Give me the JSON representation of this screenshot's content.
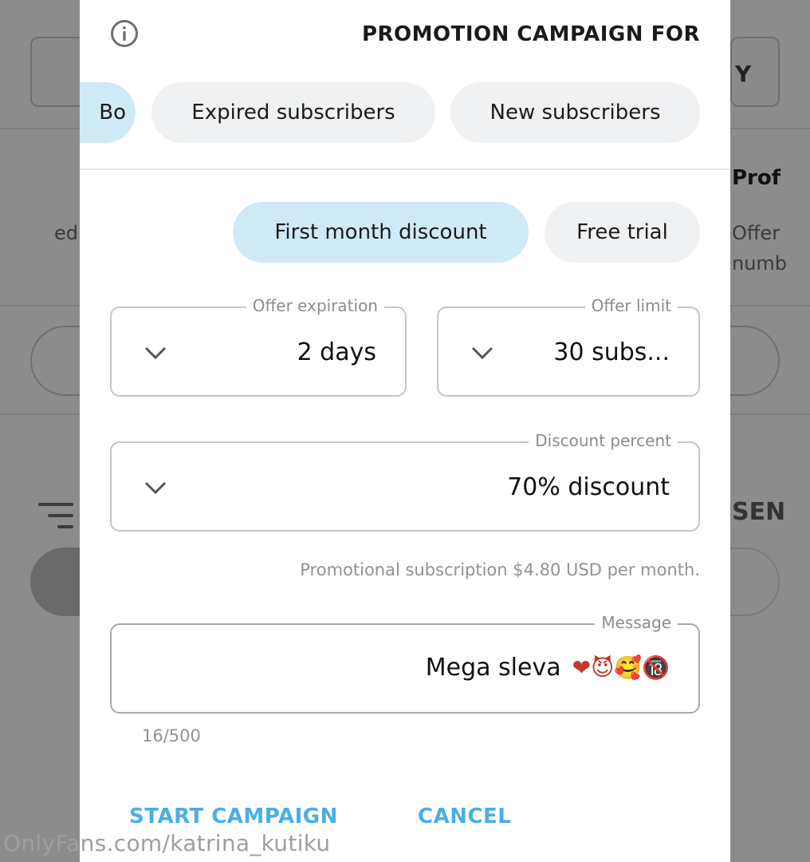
{
  "background": {
    "right_button_label": "Y",
    "right_section_title": "Prof",
    "right_desc_line1": "Offer",
    "right_desc_line2": "numb",
    "left_desc_fragment": "ed",
    "right_heading_fragment": "SEN"
  },
  "modal": {
    "title": "PROMOTION CAMPAIGN FOR",
    "audience_chips": [
      {
        "label": "New subscribers",
        "selected": false
      },
      {
        "label": "Expired subscribers",
        "selected": false
      },
      {
        "label": "Bo",
        "selected": true
      }
    ],
    "type_chips": [
      {
        "label": "Free trial",
        "selected": false
      },
      {
        "label": "First month discount",
        "selected": true
      }
    ],
    "offer_limit": {
      "label": "Offer limit",
      "value": "30 subs..."
    },
    "offer_expiration": {
      "label": "Offer expiration",
      "value": "2 days"
    },
    "discount_percent": {
      "label": "Discount percent",
      "value": "70% discount"
    },
    "helper_text": "Promotional subscription $4.80 USD per month.",
    "message": {
      "label": "Message",
      "text": "Mega sleva",
      "emojis": "❤😈🥰🔞"
    },
    "counter": "16/500",
    "cancel_label": "CANCEL",
    "start_label": "START CAMPAIGN"
  },
  "watermark": "OnlyFans.com/katrina_kutiku",
  "colors": {
    "accent": "#4aaee6",
    "chip_selected": "#cfeaf7",
    "chip_default": "#eff1f3"
  }
}
